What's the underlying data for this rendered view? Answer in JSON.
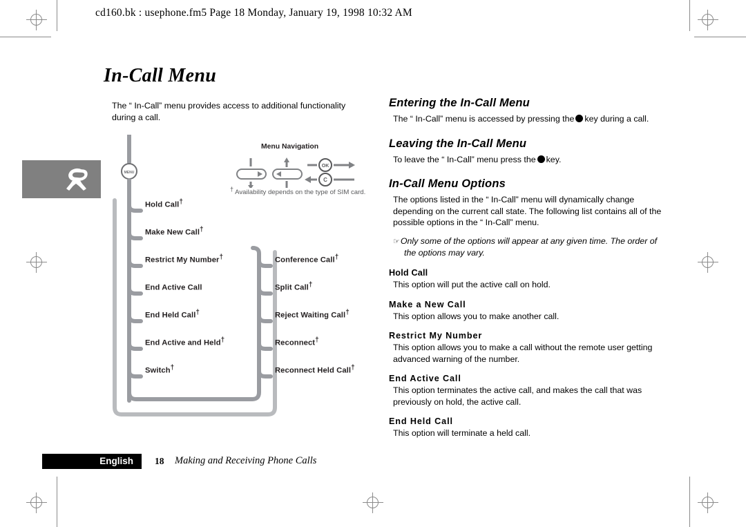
{
  "header": {
    "text": "cd160.bk : usephone.fm5  Page 18  Monday, January 19, 1998  10:32 AM"
  },
  "title": "In-Call Menu",
  "intro": "The “ In-Call” menu provides access to additional functionality during a call.",
  "diagram": {
    "legend_title": "Menu Navigation",
    "legend_note_dagger": "†",
    "legend_note": "Availability depends on the type of SIM card.",
    "menu_node_label": "MENU",
    "left_items": [
      {
        "label": "Hold Call",
        "dagger": "†"
      },
      {
        "label": "Make New Call",
        "dagger": "†"
      },
      {
        "label": "Restrict My Number",
        "dagger": "†"
      },
      {
        "label": "End Active Call",
        "dagger": ""
      },
      {
        "label": "End Held Call",
        "dagger": "†"
      },
      {
        "label": "End Active and Held",
        "dagger": "†"
      },
      {
        "label": "Switch",
        "dagger": "†"
      }
    ],
    "right_items": [
      {
        "label": "Conference Call",
        "dagger": "†"
      },
      {
        "label": "Split Call",
        "dagger": "†"
      },
      {
        "label": "Reject Waiting Call",
        "dagger": "†"
      },
      {
        "label": "Reconnect",
        "dagger": "†"
      },
      {
        "label": "Reconnect Held Call",
        "dagger": "†"
      }
    ],
    "keys": {
      "ok": "OK",
      "clear": "C"
    },
    "line_color": "#9a9ca1"
  },
  "sections": [
    {
      "heading": "Entering the In-Call Menu",
      "body_before": "The “ In-Call” menu is accessed by pressing the",
      "body_after": "key during a call."
    },
    {
      "heading": "Leaving the In-Call Menu",
      "body_before": "To leave the “ In-Call” menu press the",
      "body_after": "key."
    }
  ],
  "options_section": {
    "heading": "In-Call Menu Options",
    "body": "The options listed in the “ In-Call” menu will dynamically change depending on the current call state. The following list contains all of the possible options in the “ In-Call” menu.",
    "note_icon": "☞",
    "note": "Only some of the options will appear at any given time. The order of the options may vary.",
    "options": [
      {
        "term": "Hold Call",
        "definition": "This option will put the active call on hold."
      },
      {
        "term": "Make a New Call",
        "definition": "This option allows you to make another call."
      },
      {
        "term": "Restrict My Number",
        "definition": "This option allows you to make a call without the remote user getting advanced warning of the number."
      },
      {
        "term": "End Active Call",
        "definition": "This option terminates the active call, and makes the call that was previously on hold, the active call."
      },
      {
        "term": "End Held Call",
        "definition": "This option will terminate a held call."
      }
    ]
  },
  "footer": {
    "language": "English",
    "page_number": "18",
    "section_title": "Making and Receiving Phone Calls"
  }
}
